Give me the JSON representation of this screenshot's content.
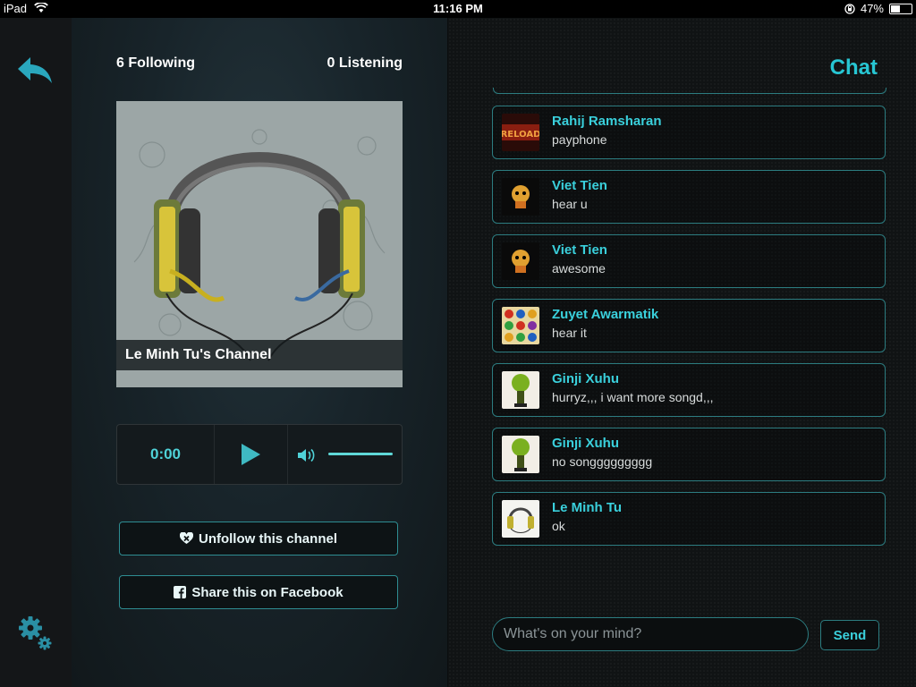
{
  "status_bar": {
    "device": "iPad",
    "time": "11:16 PM",
    "battery": "47%"
  },
  "icons": {
    "back": "back-arrow-icon",
    "settings": "gear-icon",
    "play": "play-icon",
    "volume": "volume-icon",
    "unfollow": "unfollow-heart-icon",
    "facebook": "facebook-icon"
  },
  "channel": {
    "following": "6 Following",
    "listening": "0 Listening",
    "name": "Le Minh Tu's Channel",
    "time": "0:00",
    "volume_level": 1.0,
    "unfollow_label": "Unfollow this channel",
    "share_label": "Share this on Facebook"
  },
  "chat": {
    "title": "Chat",
    "messages": [
      {
        "user": "Rahij Ramsharan",
        "text": "payphone"
      },
      {
        "user": "Viet Tien",
        "text": "hear u"
      },
      {
        "user": "Viet Tien",
        "text": "awesome"
      },
      {
        "user": "Zuyet Awarmatik",
        "text": "hear it"
      },
      {
        "user": "Ginji Xuhu",
        "text": "hurryz,,, i want more songd,,,"
      },
      {
        "user": "Ginji Xuhu",
        "text": "no songgggggggg"
      },
      {
        "user": "Le Minh Tu",
        "text": "ok"
      }
    ],
    "input_placeholder": "What's on your mind?",
    "send_label": "Send"
  },
  "colors": {
    "accent": "#27c6d3",
    "border": "#2c7c80"
  }
}
